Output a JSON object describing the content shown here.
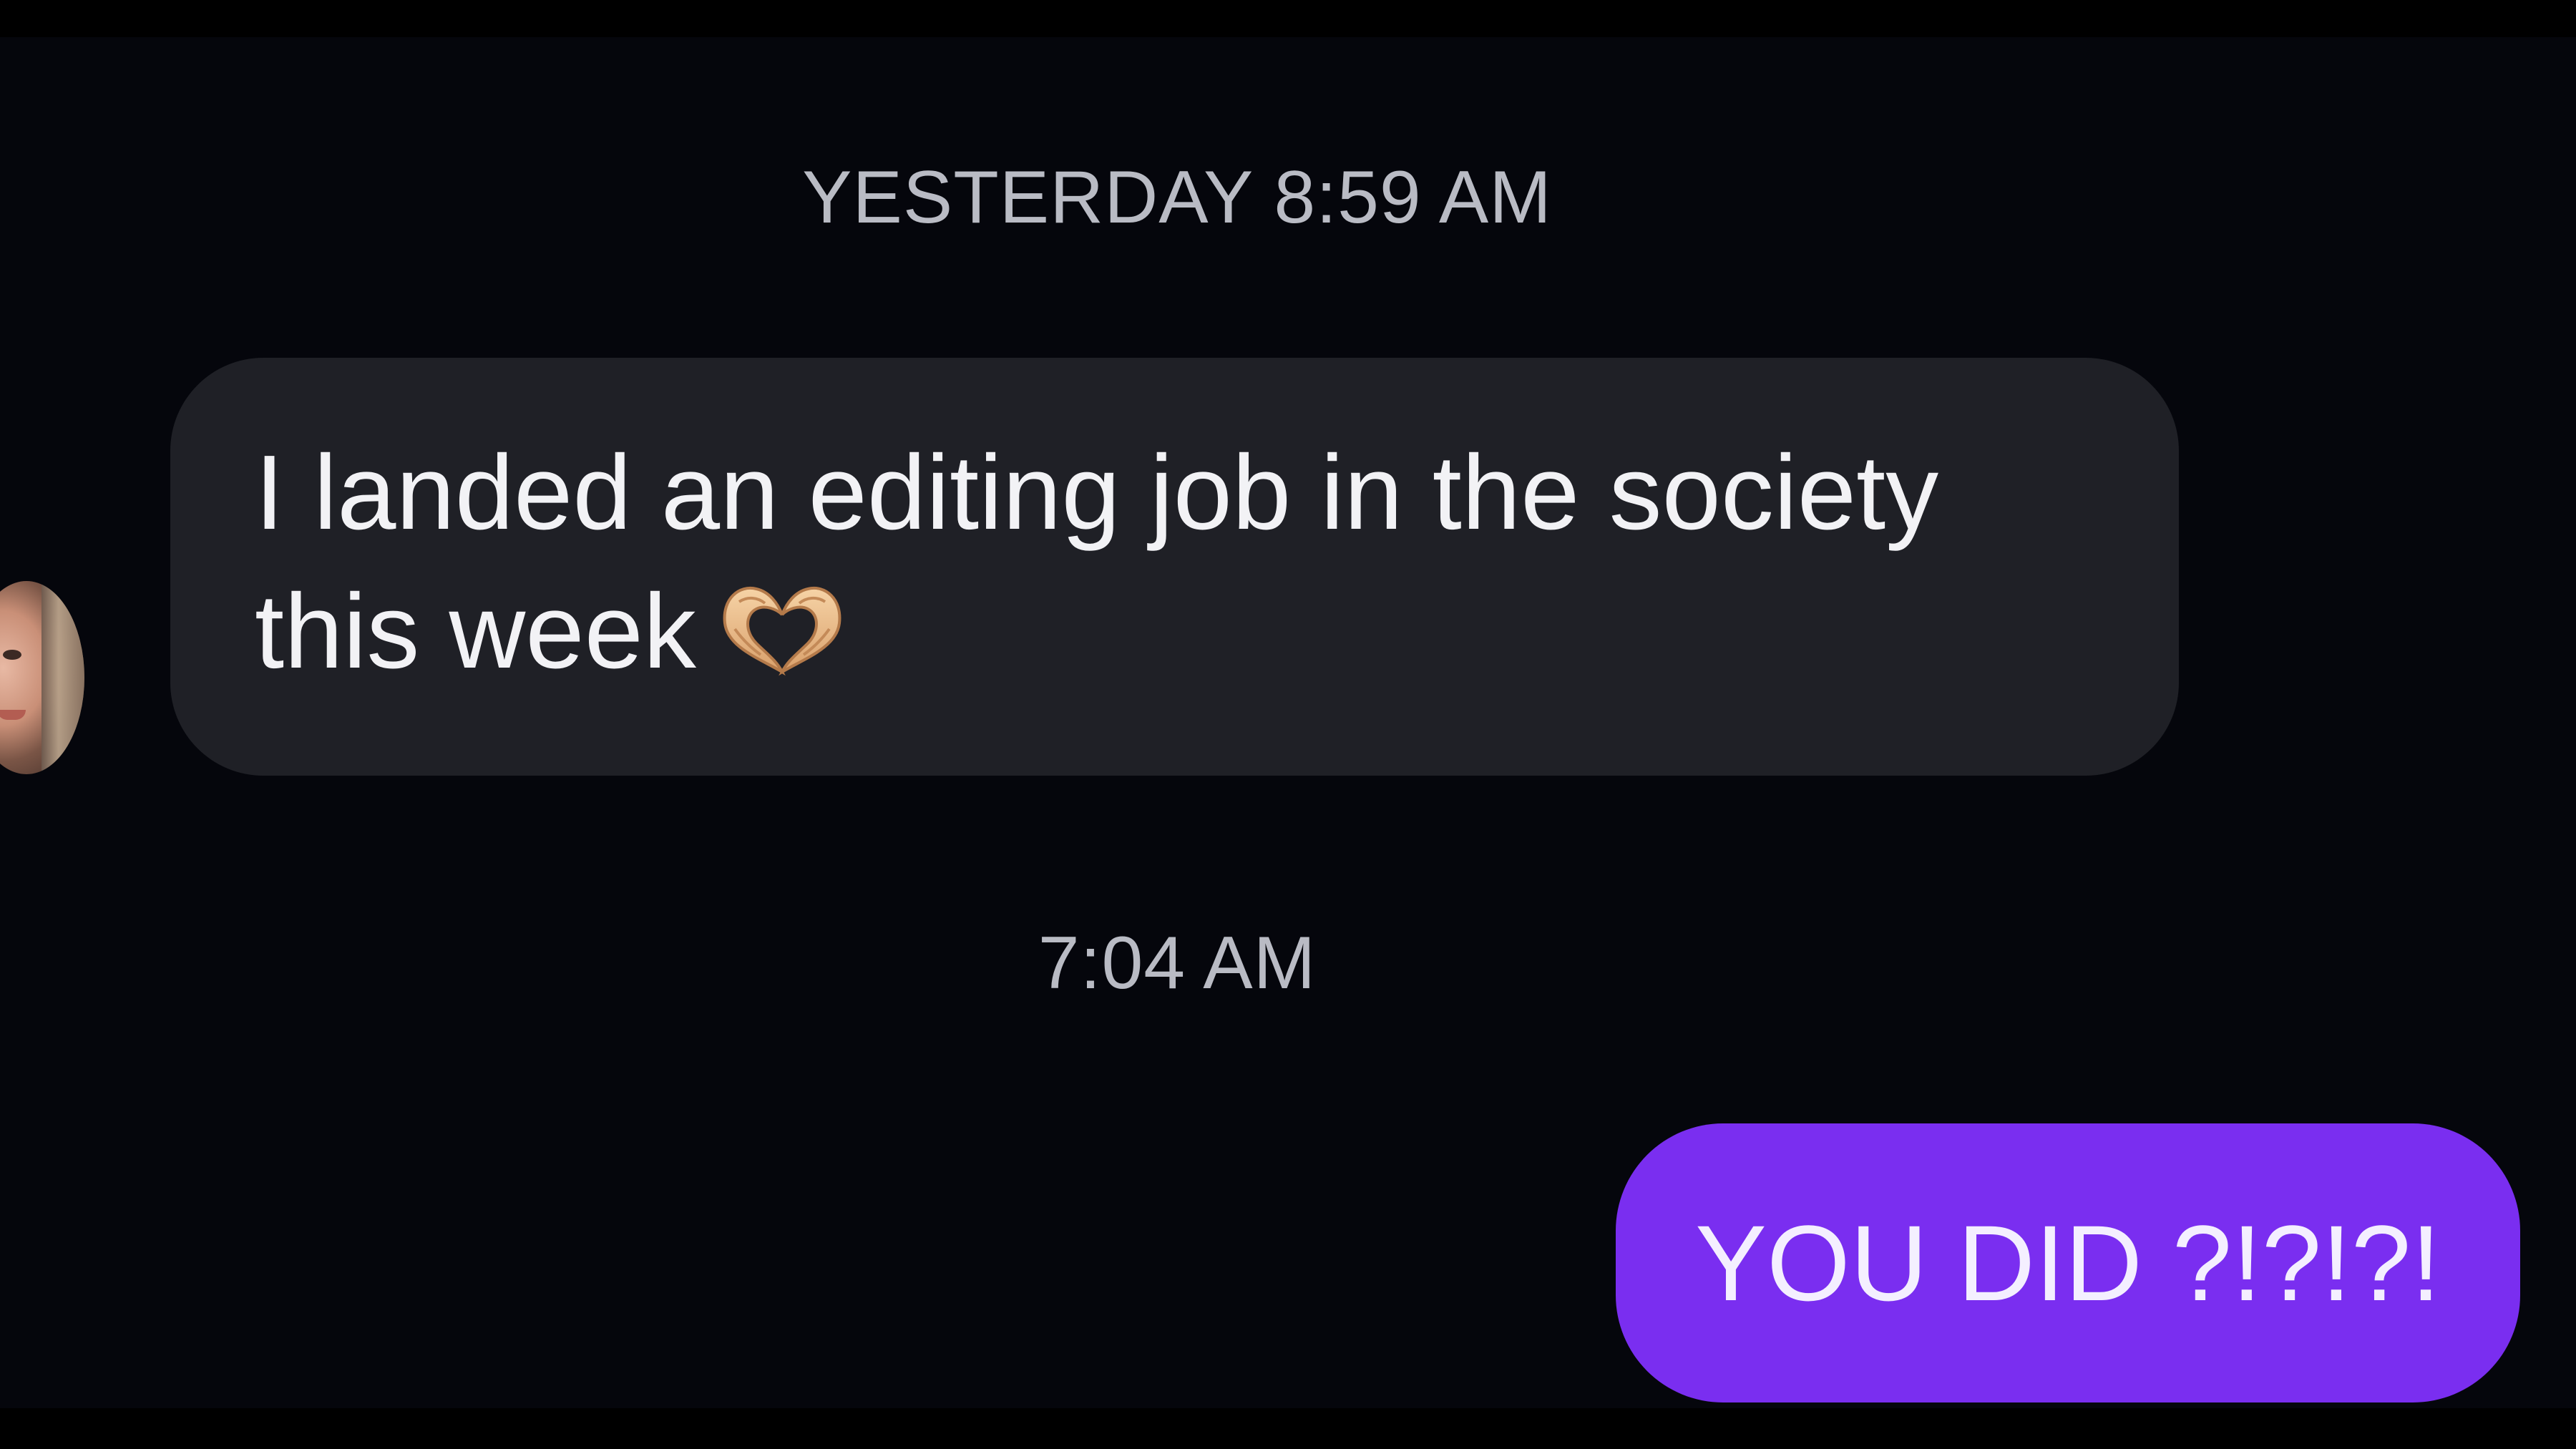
{
  "conversation": {
    "timestamp_1": "YESTERDAY 8:59 AM",
    "timestamp_2": "7:04 AM",
    "received_message": {
      "text": "I landed an editing job in the society\nthis week",
      "emoji": "heart-hands-emoji"
    },
    "sent_message": {
      "text": "YOU DID ?!?!?!"
    }
  },
  "colors": {
    "background": "#05060c",
    "received_bubble": "#1f2026",
    "sent_bubble": "#7a2ef0",
    "timestamp_text": "#b9bbc4"
  }
}
